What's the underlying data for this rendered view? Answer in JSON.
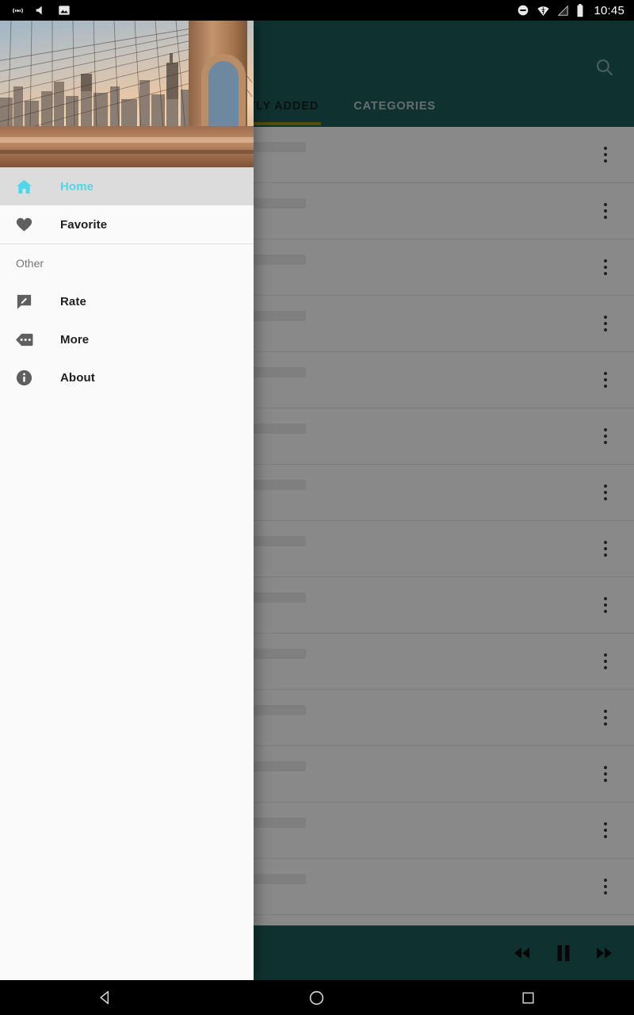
{
  "status_bar": {
    "time": "10:45",
    "left_icons": [
      "cast-icon",
      "volume-mute-icon",
      "screenshot-image-icon"
    ],
    "right_icons": [
      "do-not-disturb-icon",
      "wifi-icon",
      "signal-icon",
      "battery-icon"
    ]
  },
  "toolbar": {
    "search_icon": "search-icon",
    "background_color": "#1d5c58"
  },
  "tabs": [
    {
      "label": "RECENTLY ADDED",
      "selected": true
    },
    {
      "label": "CATEGORIES",
      "selected": false
    }
  ],
  "tab_indicator_color": "#9a8c10",
  "drawer": {
    "header_image": "brooklyn-bridge-skyline-sunset",
    "items": [
      {
        "label": "Home",
        "icon": "home-icon",
        "selected": true
      },
      {
        "label": "Favorite",
        "icon": "heart-icon",
        "selected": false
      }
    ],
    "section_label": "Other",
    "other_items": [
      {
        "label": "Rate",
        "icon": "rate-review-icon"
      },
      {
        "label": "More",
        "icon": "more-label-icon"
      },
      {
        "label": "About",
        "icon": "info-icon"
      }
    ],
    "selected_item_color": "#4fd7e8",
    "selected_item_background": "#dcdcdc"
  },
  "list": {
    "row_count": 15,
    "row_overflow_icon": "more-vert-icon"
  },
  "player": {
    "previous_icon": "fast-rewind-icon",
    "pause_icon": "pause-icon",
    "next_icon": "fast-forward-icon"
  },
  "system_nav": {
    "back": "back-triangle-icon",
    "home": "home-circle-icon",
    "recents": "recents-square-icon"
  }
}
